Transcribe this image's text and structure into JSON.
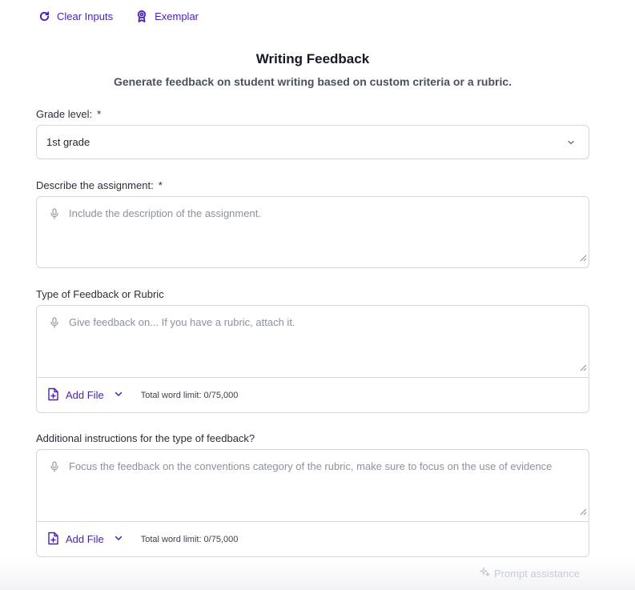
{
  "toolbar": {
    "clear_label": "Clear Inputs",
    "exemplar_label": "Exemplar"
  },
  "header": {
    "title": "Writing Feedback",
    "subtitle": "Generate feedback on student writing based on custom criteria or a rubric."
  },
  "form": {
    "grade": {
      "label": "Grade level:",
      "required_mark": "*",
      "value": "1st grade"
    },
    "assignment": {
      "label": "Describe the assignment:",
      "required_mark": "*",
      "placeholder": "Include the description of the assignment."
    },
    "feedback_type": {
      "label": "Type of Feedback or Rubric",
      "placeholder": "Give feedback on... If you have a rubric, attach it.",
      "add_file": "Add File",
      "word_limit": "Total word limit: 0/75,000"
    },
    "additional": {
      "label": "Additional instructions for the type of feedback?",
      "placeholder": "Focus the feedback on the conventions category of the rubric, make sure to focus on the use of evidence",
      "add_file": "Add File",
      "word_limit": "Total word limit: 0/75,000"
    }
  },
  "footer": {
    "prompt_assistance": "Prompt assistance"
  },
  "colors": {
    "accent": "#4a1fb8",
    "border": "#d4d6dc",
    "placeholder": "#8c919c"
  },
  "icons": [
    "refresh-icon",
    "award-icon",
    "chevron-down-icon",
    "microphone-icon",
    "file-plus-icon",
    "sparkle-icon",
    "resize-grip-icon"
  ]
}
